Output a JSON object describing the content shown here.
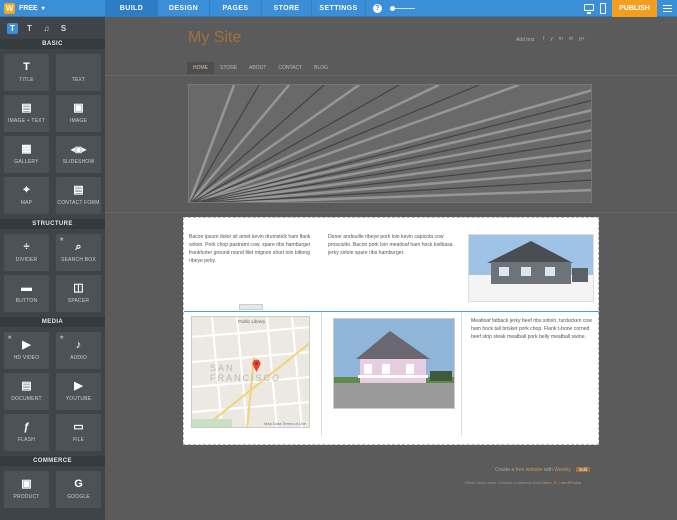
{
  "topbar": {
    "brand_plan": "FREE",
    "tabs": [
      {
        "label": "BUILD",
        "active": true
      },
      {
        "label": "DESIGN",
        "active": false
      },
      {
        "label": "PAGES",
        "active": false
      },
      {
        "label": "STORE",
        "active": false
      },
      {
        "label": "SETTINGS",
        "active": false
      }
    ],
    "help": "?",
    "zoom_level": 0.1,
    "publish_label": "PUBLISH",
    "accent": "#3b8fd8",
    "publish_color": "#f59d1c"
  },
  "sidebar": {
    "font_tools": [
      "T",
      "T",
      "♫",
      "S"
    ],
    "sections": [
      {
        "title": "BASIC",
        "items": [
          {
            "label": "TITLE",
            "icon": "title-icon",
            "starred": false
          },
          {
            "label": "TEXT",
            "icon": "text-icon",
            "starred": false
          },
          {
            "label": "IMAGE + TEXT",
            "icon": "image-text-icon",
            "starred": false
          },
          {
            "label": "IMAGE",
            "icon": "image-icon",
            "starred": false
          },
          {
            "label": "GALLERY",
            "icon": "gallery-icon",
            "starred": false
          },
          {
            "label": "SLIDESHOW",
            "icon": "slideshow-icon",
            "starred": false
          },
          {
            "label": "MAP",
            "icon": "map-icon",
            "starred": false
          },
          {
            "label": "CONTACT FORM",
            "icon": "contact-form-icon",
            "starred": false
          }
        ]
      },
      {
        "title": "STRUCTURE",
        "items": [
          {
            "label": "DIVIDER",
            "icon": "divider-icon",
            "starred": false
          },
          {
            "label": "SEARCH BOX",
            "icon": "search-box-icon",
            "starred": true
          },
          {
            "label": "BUTTON",
            "icon": "button-icon",
            "starred": false
          },
          {
            "label": "SPACER",
            "icon": "spacer-icon",
            "starred": false
          }
        ]
      },
      {
        "title": "MEDIA",
        "items": [
          {
            "label": "HD VIDEO",
            "icon": "hd-video-icon",
            "starred": true
          },
          {
            "label": "AUDIO",
            "icon": "audio-icon",
            "starred": true
          },
          {
            "label": "DOCUMENT",
            "icon": "document-icon",
            "starred": false
          },
          {
            "label": "YOUTUBE",
            "icon": "youtube-icon",
            "starred": false
          },
          {
            "label": "FLASH",
            "icon": "flash-icon",
            "starred": false
          },
          {
            "label": "FILE",
            "icon": "file-icon",
            "starred": false
          }
        ]
      },
      {
        "title": "COMMERCE",
        "items": [
          {
            "label": "PRODUCT",
            "icon": "product-icon",
            "starred": false
          },
          {
            "label": "GOOGLE",
            "icon": "google-icon",
            "starred": false
          }
        ]
      }
    ]
  },
  "site": {
    "title": "My Site",
    "add_text": "Add text",
    "social": [
      "f",
      "y",
      "in",
      "✉",
      "g+"
    ],
    "nav": [
      {
        "label": "HOME",
        "active": true
      },
      {
        "label": "STORE",
        "active": false
      },
      {
        "label": "ABOUT",
        "active": false
      },
      {
        "label": "CONTACT",
        "active": false
      },
      {
        "label": "BLOG",
        "active": false
      }
    ]
  },
  "content": {
    "para1": "Bacon ipsum dolor sit amet kevin drumstick ham flank sirloin. Pork chop pastrami cow, spare ribs hamburger frankfurter ground round filet mignon short loin biltong ribeye jerky.",
    "para2": "Doner andouille ribeye pork loin kevin capicola cow prosciutto. Bacon pork loin meatloaf ham hock kielbasa jerky sirloin spare ribs hamburger.",
    "para3": "Meatloaf fatback jerky beef ribs sirloin, turducken cow ham hock tail brisket pork chop. Flank t-bone corned beef strip steak meatball pork belly meatball swine.",
    "map_label": "Public Library",
    "map_city": "SAN FRANCISCO",
    "map_footer": "Map Data   Terms of Use"
  },
  "footer": {
    "line1_pre": "Create a",
    "line1_link": "free website",
    "line1_mid": "with",
    "line1_brand": "Weebly",
    "line1_btn": "Edit",
    "line2_pre": "Photo used under Creative Commons from",
    "line2_link": "Dave_S. / nerdPhotos"
  }
}
